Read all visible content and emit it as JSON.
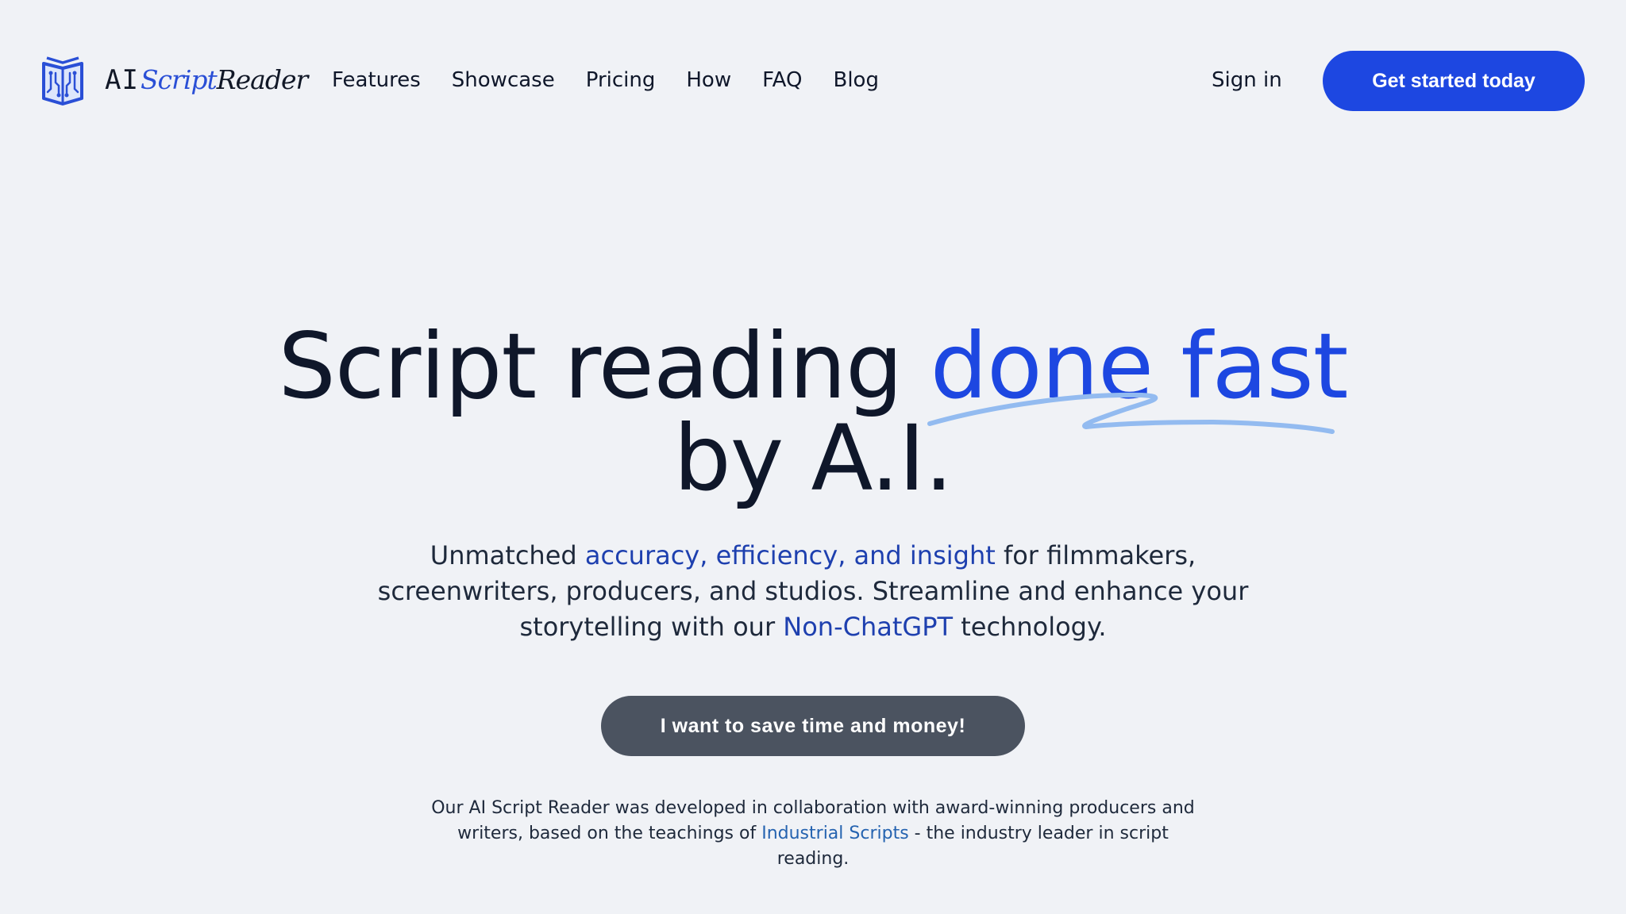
{
  "brand": {
    "name_part1": "AI",
    "name_part2": "Script",
    "name_part3": "Reader",
    "accent_color": "#1d47e1",
    "icon": "book-circuit-icon"
  },
  "nav": {
    "items": [
      {
        "label": "Features"
      },
      {
        "label": "Showcase"
      },
      {
        "label": "Pricing"
      },
      {
        "label": "How"
      },
      {
        "label": "FAQ"
      },
      {
        "label": "Blog"
      }
    ],
    "sign_in_label": "Sign in",
    "cta_label": "Get started today"
  },
  "hero": {
    "title_part1": "Script reading ",
    "title_accent": "done fast",
    "title_line2": "by A.I.",
    "subtitle_part1": "Unmatched ",
    "subtitle_highlight1": "accuracy, efficiency, and insight",
    "subtitle_part2": " for filmmakers, screenwriters, producers, and studios. Streamline and enhance your storytelling with our ",
    "subtitle_highlight2": "Non-ChatGPT",
    "subtitle_part3": " technology.",
    "cta_label": "I want to save time and money!",
    "note_part1": "Our AI Script Reader was developed in collaboration with award-winning producers and writers, based on the teachings of ",
    "note_link": "Industrial Scripts",
    "note_part2": " - the industry leader in script reading."
  }
}
